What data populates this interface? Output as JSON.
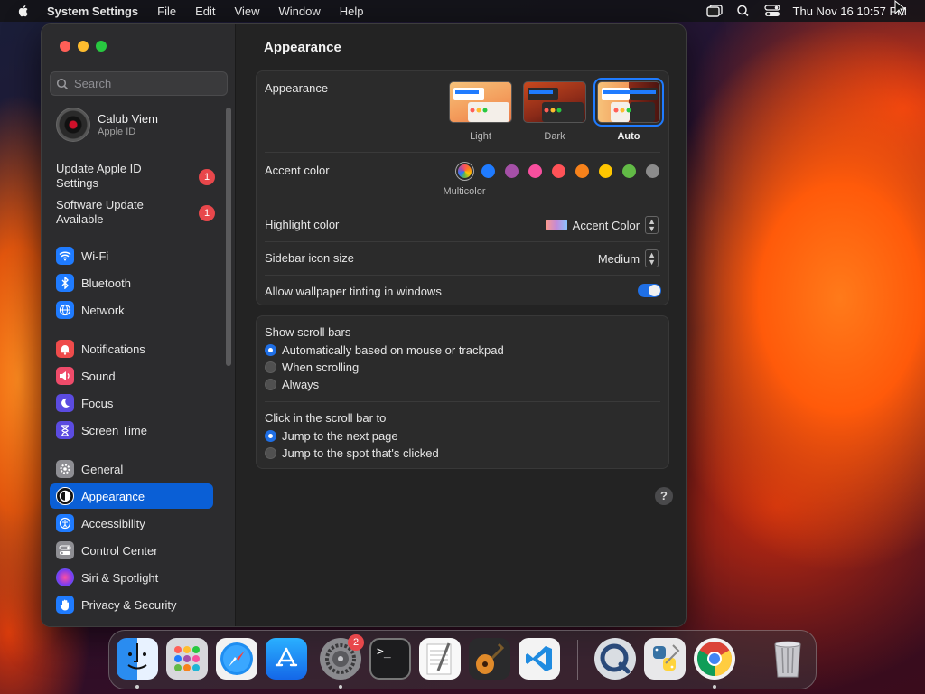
{
  "menubar": {
    "app_name": "System Settings",
    "menus": [
      "File",
      "Edit",
      "View",
      "Window",
      "Help"
    ],
    "clock": "Thu Nov 16  10:57 PM"
  },
  "sidebar": {
    "search_placeholder": "Search",
    "profile": {
      "name": "Calub Viem",
      "subtitle": "Apple ID"
    },
    "notices": [
      {
        "label": "Update Apple ID Settings",
        "badge": "1"
      },
      {
        "label": "Software Update Available",
        "badge": "1"
      }
    ],
    "items": [
      {
        "label": "Wi-Fi",
        "icon": "wifi-icon",
        "color": "#1f7bff"
      },
      {
        "label": "Bluetooth",
        "icon": "bluetooth-icon",
        "color": "#1f7bff"
      },
      {
        "label": "Network",
        "icon": "globe-icon",
        "color": "#1f7bff"
      },
      {
        "label": "Notifications",
        "icon": "bell-icon",
        "color": "#ef4b4b"
      },
      {
        "label": "Sound",
        "icon": "speaker-icon",
        "color": "#ef4b6a"
      },
      {
        "label": "Focus",
        "icon": "moon-icon",
        "color": "#5b4be0"
      },
      {
        "label": "Screen Time",
        "icon": "hourglass-icon",
        "color": "#5b4be0"
      },
      {
        "label": "General",
        "icon": "gear-icon",
        "color": "#8e8e93"
      },
      {
        "label": "Appearance",
        "icon": "appearance-icon",
        "color": "#111111"
      },
      {
        "label": "Accessibility",
        "icon": "accessibility-icon",
        "color": "#1f7bff"
      },
      {
        "label": "Control Center",
        "icon": "toggles-icon",
        "color": "#8e8e93"
      },
      {
        "label": "Siri & Spotlight",
        "icon": "siri-icon",
        "color": "#9b3fd0"
      },
      {
        "label": "Privacy & Security",
        "icon": "hand-icon",
        "color": "#1f7bff"
      }
    ],
    "active_item": "Appearance"
  },
  "main": {
    "title": "Appearance",
    "appearance": {
      "label": "Appearance",
      "options": [
        "Light",
        "Dark",
        "Auto"
      ],
      "selected": "Auto"
    },
    "accent": {
      "label": "Accent color",
      "selected_label": "Multicolor",
      "colors": [
        "multicolor",
        "#1f7bff",
        "#a550a7",
        "#f74f9e",
        "#ff5257",
        "#f7821b",
        "#ffc600",
        "#62ba46",
        "#8c8c8c"
      ]
    },
    "highlight": {
      "label": "Highlight color",
      "value": "Accent Color"
    },
    "sidebar_icon_size": {
      "label": "Sidebar icon size",
      "value": "Medium"
    },
    "wallpaper_tinting": {
      "label": "Allow wallpaper tinting in windows",
      "enabled": true
    },
    "scroll_bars": {
      "label": "Show scroll bars",
      "options": [
        "Automatically based on mouse or trackpad",
        "When scrolling",
        "Always"
      ],
      "selected": "Automatically based on mouse or trackpad"
    },
    "click_scroll": {
      "label": "Click in the scroll bar to",
      "options": [
        "Jump to the next page",
        "Jump to the spot that's clicked"
      ],
      "selected": "Jump to the next page"
    },
    "help_label": "?"
  },
  "dock": {
    "apps": [
      {
        "name": "Finder",
        "icon": "finder-icon",
        "running": true
      },
      {
        "name": "Launchpad",
        "icon": "launchpad-icon",
        "running": false
      },
      {
        "name": "Safari",
        "icon": "safari-icon",
        "running": false
      },
      {
        "name": "App Store",
        "icon": "app-store-icon",
        "running": false
      },
      {
        "name": "System Settings",
        "icon": "settings-icon",
        "running": true,
        "badge": "2"
      },
      {
        "name": "Terminal",
        "icon": "terminal-icon",
        "running": false
      },
      {
        "name": "TextEdit",
        "icon": "textedit-icon",
        "running": false
      },
      {
        "name": "GarageBand",
        "icon": "guitar-icon",
        "running": false
      },
      {
        "name": "Visual Studio Code",
        "icon": "vscode-icon",
        "running": false
      },
      {
        "name": "QuickTime Player",
        "icon": "quicktime-icon",
        "running": false
      },
      {
        "name": "Python Launcher",
        "icon": "python-icon",
        "running": false
      },
      {
        "name": "Google Chrome",
        "icon": "chrome-icon",
        "running": true
      },
      {
        "name": "Trash",
        "icon": "trash-icon",
        "running": false
      }
    ]
  }
}
